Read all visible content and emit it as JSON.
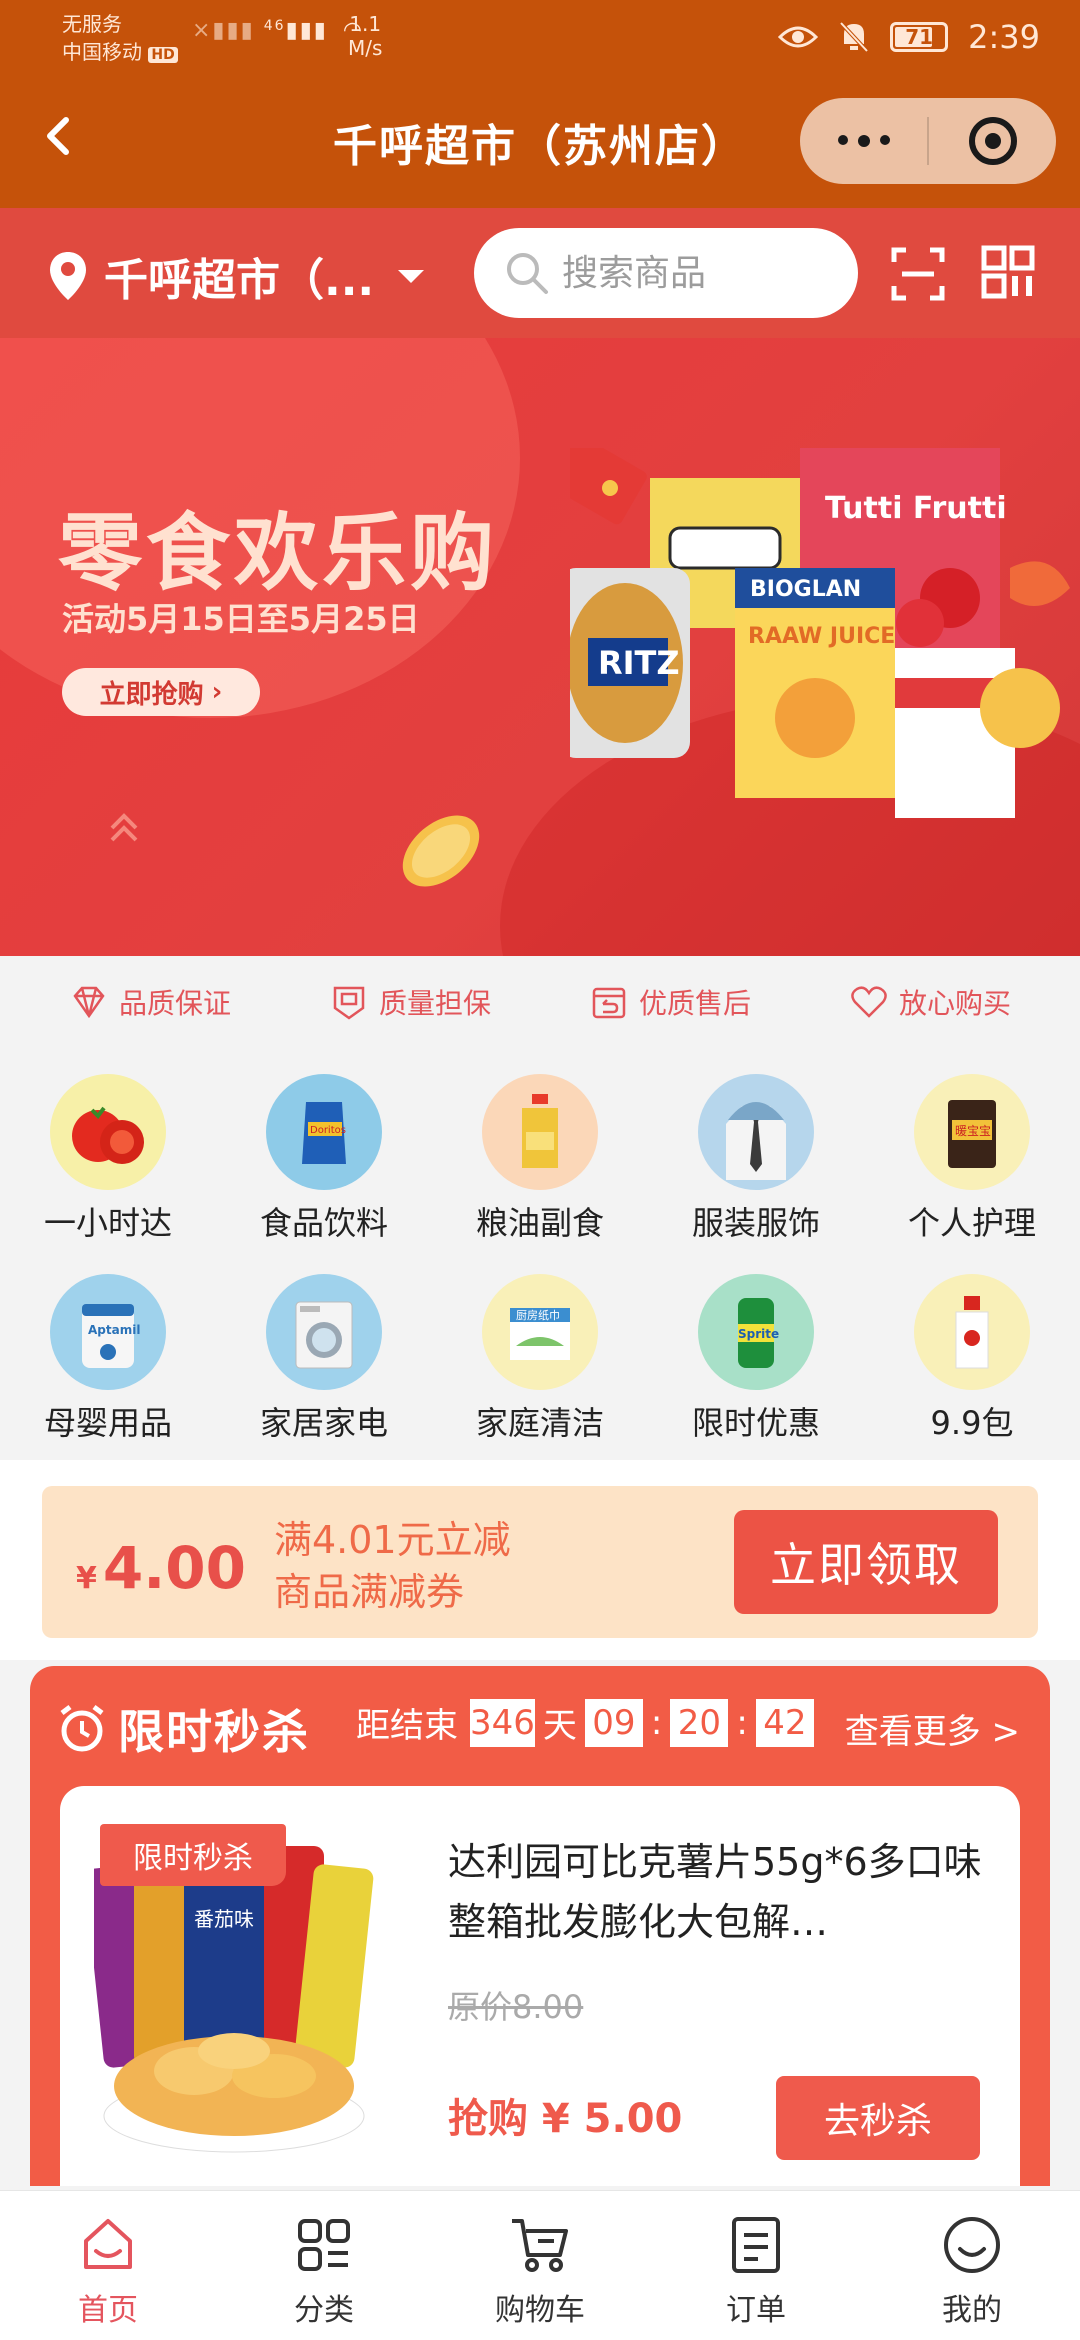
{
  "status_bar": {
    "carrier_line1": "无服务",
    "carrier_line2": "中国移动",
    "hd_badge": "HD",
    "network": "46",
    "speed_value": "1.1",
    "speed_unit": "M/s",
    "battery": "71",
    "time": "2:39",
    "icons": [
      "eye-icon",
      "bell-muted-icon",
      "wifi-icon",
      "signal-icon"
    ]
  },
  "nav": {
    "title": "千呼超市（苏州店）"
  },
  "location_bar": {
    "store_name": "千呼超市（...",
    "search_placeholder": "搜索商品"
  },
  "banner": {
    "title": "零食欢乐购",
    "subtitle": "活动5月15日至5月25日",
    "button": "立即抢购"
  },
  "guarantees": [
    {
      "label": "品质保证",
      "icon": "diamond-icon"
    },
    {
      "label": "质量担保",
      "icon": "certificate-icon"
    },
    {
      "label": "优质售后",
      "icon": "return-icon"
    },
    {
      "label": "放心购买",
      "icon": "heart-icon"
    }
  ],
  "categories": [
    {
      "label": "一小时达",
      "icon": "tomato-icon",
      "bg": "#f7f0a8"
    },
    {
      "label": "食品饮料",
      "icon": "chips-bag-icon",
      "bg": "#8ecbe8"
    },
    {
      "label": "粮油副食",
      "icon": "oil-bottle-icon",
      "bg": "#fbd7b8"
    },
    {
      "label": "服装服饰",
      "icon": "shirt-icon",
      "bg": "#b6d6ec"
    },
    {
      "label": "个人护理",
      "icon": "warmer-pack-icon",
      "bg": "#f9f0b8"
    },
    {
      "label": "母婴用品",
      "icon": "milk-powder-icon",
      "bg": "#9fd2ec"
    },
    {
      "label": "家居家电",
      "icon": "washing-machine-icon",
      "bg": "#9fd2ec"
    },
    {
      "label": "家庭清洁",
      "icon": "kitchen-paper-icon",
      "bg": "#f9f0b8"
    },
    {
      "label": "限时优惠",
      "icon": "soda-can-icon",
      "bg": "#a8e0c8"
    },
    {
      "label": "9.9包",
      "icon": "lotion-bottle-icon",
      "bg": "#f9f0b8"
    }
  ],
  "coupon": {
    "currency": "¥",
    "amount": "4.00",
    "line1": "满4.01元立减",
    "line2": "商品满减券",
    "button": "立即领取"
  },
  "flash_sale": {
    "title": "限时秒杀",
    "ends_label": "距结束",
    "days": "346",
    "days_unit": "天",
    "hours": "09",
    "minutes": "20",
    "seconds": "42",
    "see_more": "查看更多 >",
    "product": {
      "tag": "限时秒杀",
      "name": "达利园可比克薯片55g*6多口味整箱批发膨化大包解…",
      "original_price": "原价8.00",
      "sale_price": "抢购 ¥ 5.00",
      "button": "去秒杀"
    }
  },
  "tabbar": [
    {
      "label": "首页",
      "icon": "home-icon",
      "active": true
    },
    {
      "label": "分类",
      "icon": "category-icon",
      "active": false
    },
    {
      "label": "购物车",
      "icon": "cart-icon",
      "active": false
    },
    {
      "label": "订单",
      "icon": "order-icon",
      "active": false
    },
    {
      "label": "我的",
      "icon": "profile-icon",
      "active": false
    }
  ],
  "colors": {
    "nav_bg": "#c5520a",
    "location_bg": "#e04a3f",
    "accent": "#ef5a4c",
    "active_tab": "#e4555e"
  }
}
